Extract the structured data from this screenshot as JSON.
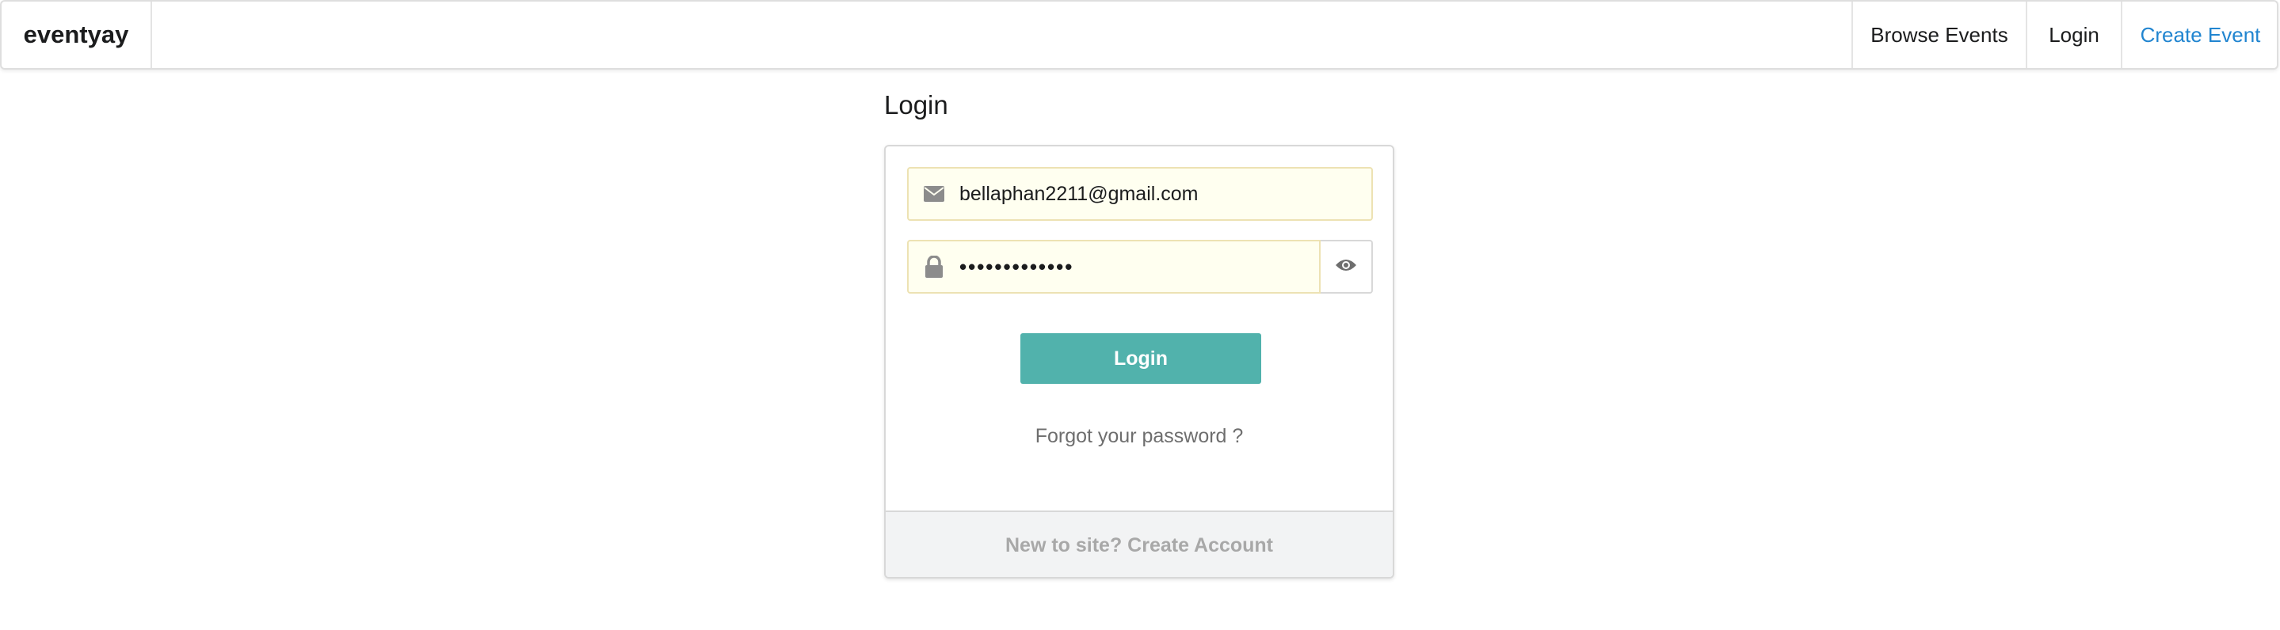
{
  "navbar": {
    "brand": "eventyay",
    "items": [
      {
        "label": "Browse Events"
      },
      {
        "label": "Login"
      },
      {
        "label": "Create Event"
      }
    ],
    "accent_color": "#2185d0"
  },
  "page": {
    "title": "Login"
  },
  "login_form": {
    "email": {
      "value": "bellaphan2211@gmail.com",
      "icon": "envelope-icon"
    },
    "password": {
      "value": "•••••••••••••",
      "icon": "lock-icon",
      "toggle_icon": "eye-icon"
    },
    "submit_label": "Login",
    "submit_color": "#51b2ac",
    "forgot_label": "Forgot your password ?",
    "footer_label": "New to site? Create Account"
  }
}
